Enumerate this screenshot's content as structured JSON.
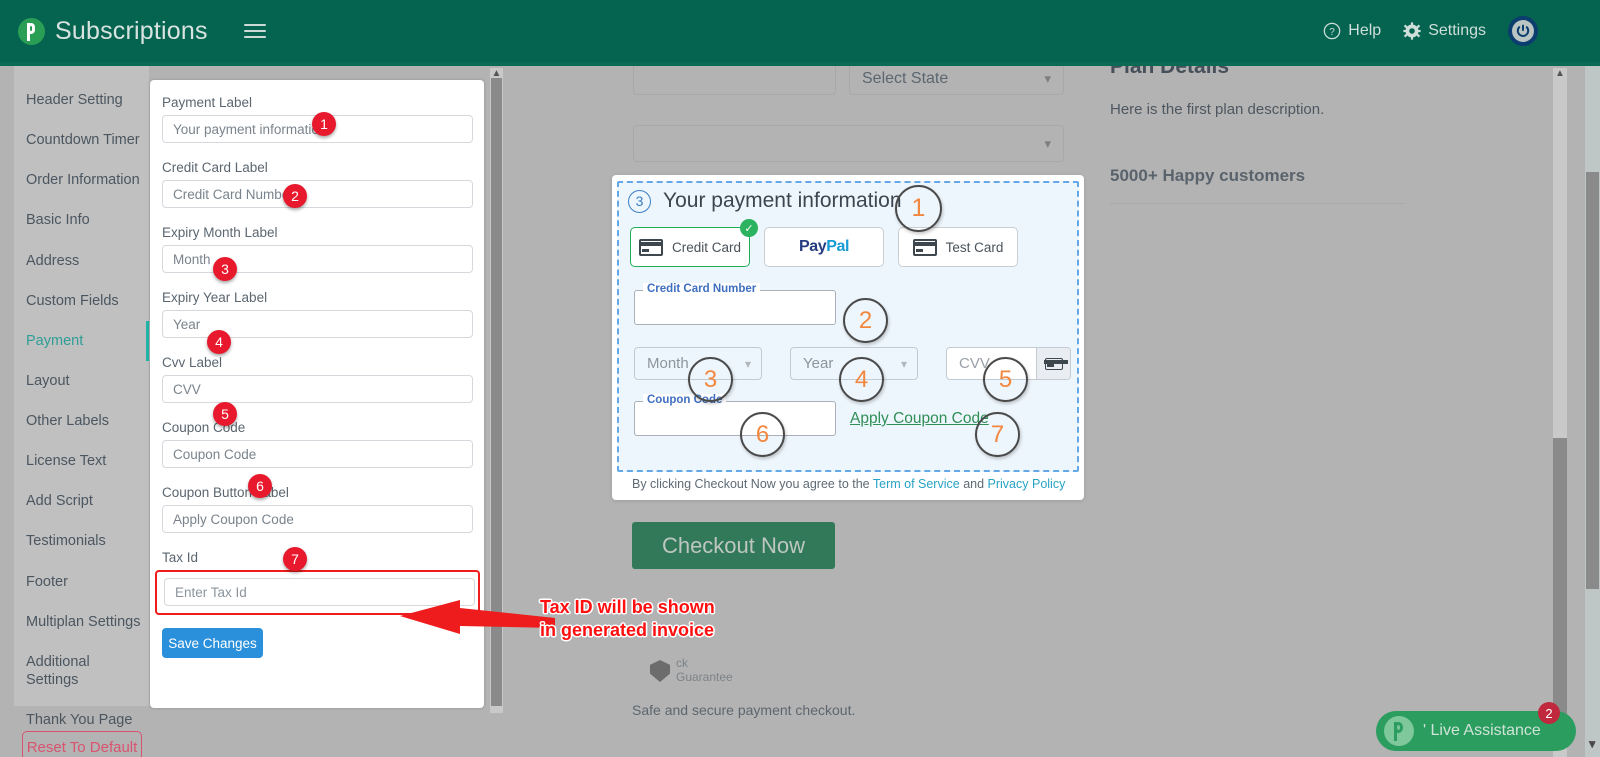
{
  "topbar": {
    "brand": "Subscriptions",
    "menu_icon": "hamburger-icon",
    "help": "Help",
    "settings": "Settings",
    "power_icon": "power-icon",
    "bg_color": "#046450"
  },
  "sidebar": {
    "items": [
      {
        "label": "Header Setting",
        "active": false
      },
      {
        "label": "Countdown Timer",
        "active": false
      },
      {
        "label": "Order Information",
        "active": false
      },
      {
        "label": "Basic Info",
        "active": false
      },
      {
        "label": "Address",
        "active": false
      },
      {
        "label": "Custom Fields",
        "active": false
      },
      {
        "label": "Payment",
        "active": true
      },
      {
        "label": "Layout",
        "active": false
      },
      {
        "label": "Other Labels",
        "active": false
      },
      {
        "label": "License Text",
        "active": false
      },
      {
        "label": "Add Script",
        "active": false
      },
      {
        "label": "Testimonials",
        "active": false
      },
      {
        "label": "Footer",
        "active": false
      },
      {
        "label": "Multiplan Settings",
        "active": false
      },
      {
        "label": "Additional Settings",
        "active": false
      },
      {
        "label": "Thank You Page",
        "active": false
      }
    ],
    "active_color": "#2e9e96",
    "reset_button": "Reset To Default"
  },
  "settings_panel": {
    "fields": [
      {
        "label": "Payment Label",
        "value": "Your payment information",
        "marker": "1"
      },
      {
        "label": "Credit Card Label",
        "value": "Credit Card Number",
        "marker": "2"
      },
      {
        "label": "Expiry Month Label",
        "value": "Month",
        "marker": "3"
      },
      {
        "label": "Expiry Year Label",
        "value": "Year",
        "marker": "4"
      },
      {
        "label": "Cvv Label",
        "value": "CVV",
        "marker": "5"
      },
      {
        "label": "Coupon Code",
        "value": "Coupon Code",
        "marker": "6"
      },
      {
        "label": "Coupon Button Label",
        "value": "Apply Coupon Code",
        "marker": "7"
      }
    ],
    "tax_id": {
      "label": "Tax Id",
      "placeholder": "Enter Tax Id",
      "highlight_color": "#ee1c1c"
    },
    "save_label": "Save Changes",
    "save_color": "#2a90db"
  },
  "annotation": {
    "text": "Tax ID will be shown\nin  generated invoice",
    "color": "#ff0f0f"
  },
  "preview": {
    "top_fields": {
      "state_select": "Select State",
      "blank_field": "",
      "blank_select": ""
    },
    "step_number": "3",
    "heading": "Your payment information",
    "heading_marker": "1",
    "methods": [
      {
        "label": "Credit Card",
        "icon": "credit-card-icon",
        "selected": true
      },
      {
        "label": "PayPal",
        "icon": "paypal-icon",
        "selected": false
      },
      {
        "label": "Test  Card",
        "icon": "credit-card-icon",
        "selected": false
      }
    ],
    "card_number": {
      "legend": "Credit Card Number",
      "value": "",
      "marker": "2"
    },
    "month": {
      "placeholder": "Month",
      "marker": "3"
    },
    "year": {
      "placeholder": "Year",
      "marker": "4"
    },
    "cvv": {
      "placeholder": "CVV",
      "marker": "5",
      "icon": "credit-card-icon"
    },
    "coupon": {
      "legend": "Coupon Code",
      "value": "",
      "marker": "6"
    },
    "apply_coupon": {
      "label": "Apply Coupon Code",
      "marker": "7",
      "color": "#2f8f56"
    },
    "terms": {
      "prefix": "By clicking Checkout Now you agree to the ",
      "link1": "Term of Service",
      "middle": " and ",
      "link2": "Privacy Policy"
    },
    "checkout_button": "Checkout Now",
    "checkout_color": "#32795a",
    "secure_badge_top": "ck",
    "secure_badge_sub": "Guarantee",
    "safe_text": "Safe and secure payment checkout."
  },
  "plan_panel": {
    "title": "Plan Details",
    "description": "Here is the first plan description.",
    "happy": "5000+ Happy customers"
  },
  "live_assistance": {
    "label": "' Live Assistance",
    "badge": "2"
  }
}
